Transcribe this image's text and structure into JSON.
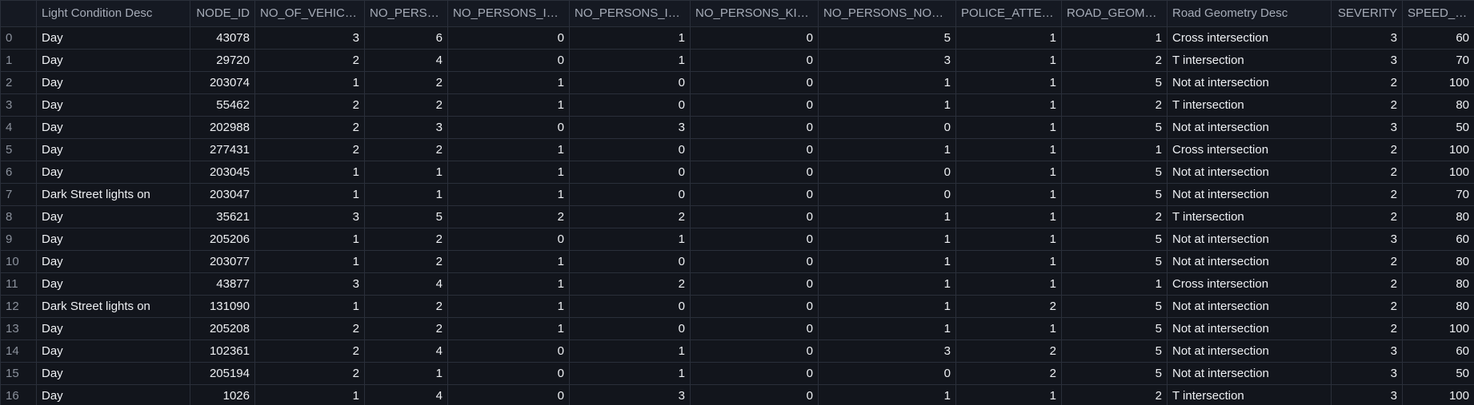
{
  "table": {
    "columns": [
      {
        "label": "",
        "align": "left"
      },
      {
        "label": "Light Condition Desc",
        "align": "left"
      },
      {
        "label": "NODE_ID",
        "align": "right"
      },
      {
        "label": "NO_OF_VEHICLES",
        "align": "right"
      },
      {
        "label": "NO_PERSO...",
        "align": "right"
      },
      {
        "label": "NO_PERSONS_INJ...",
        "align": "right"
      },
      {
        "label": "NO_PERSONS_INJ...",
        "align": "right"
      },
      {
        "label": "NO_PERSONS_KILL...",
        "align": "right"
      },
      {
        "label": "NO_PERSONS_NOT_...",
        "align": "right"
      },
      {
        "label": "POLICE_ATTEND",
        "align": "right"
      },
      {
        "label": "ROAD_GEOME...",
        "align": "right"
      },
      {
        "label": "Road Geometry Desc",
        "align": "left"
      },
      {
        "label": "SEVERITY",
        "align": "right"
      },
      {
        "label": "SPEED_ZONE",
        "align": "right"
      }
    ],
    "rows": [
      [
        "0",
        "Day",
        "43078",
        "3",
        "6",
        "0",
        "1",
        "0",
        "5",
        "1",
        "1",
        "Cross intersection",
        "3",
        "60"
      ],
      [
        "1",
        "Day",
        "29720",
        "2",
        "4",
        "0",
        "1",
        "0",
        "3",
        "1",
        "2",
        "T intersection",
        "3",
        "70"
      ],
      [
        "2",
        "Day",
        "203074",
        "1",
        "2",
        "1",
        "0",
        "0",
        "1",
        "1",
        "5",
        "Not at intersection",
        "2",
        "100"
      ],
      [
        "3",
        "Day",
        "55462",
        "2",
        "2",
        "1",
        "0",
        "0",
        "1",
        "1",
        "2",
        "T intersection",
        "2",
        "80"
      ],
      [
        "4",
        "Day",
        "202988",
        "2",
        "3",
        "0",
        "3",
        "0",
        "0",
        "1",
        "5",
        "Not at intersection",
        "3",
        "50"
      ],
      [
        "5",
        "Day",
        "277431",
        "2",
        "2",
        "1",
        "0",
        "0",
        "1",
        "1",
        "1",
        "Cross intersection",
        "2",
        "100"
      ],
      [
        "6",
        "Day",
        "203045",
        "1",
        "1",
        "1",
        "0",
        "0",
        "0",
        "1",
        "5",
        "Not at intersection",
        "2",
        "100"
      ],
      [
        "7",
        "Dark Street lights on",
        "203047",
        "1",
        "1",
        "1",
        "0",
        "0",
        "0",
        "1",
        "5",
        "Not at intersection",
        "2",
        "70"
      ],
      [
        "8",
        "Day",
        "35621",
        "3",
        "5",
        "2",
        "2",
        "0",
        "1",
        "1",
        "2",
        "T intersection",
        "2",
        "80"
      ],
      [
        "9",
        "Day",
        "205206",
        "1",
        "2",
        "0",
        "1",
        "0",
        "1",
        "1",
        "5",
        "Not at intersection",
        "3",
        "60"
      ],
      [
        "10",
        "Day",
        "203077",
        "1",
        "2",
        "1",
        "0",
        "0",
        "1",
        "1",
        "5",
        "Not at intersection",
        "2",
        "80"
      ],
      [
        "11",
        "Day",
        "43877",
        "3",
        "4",
        "1",
        "2",
        "0",
        "1",
        "1",
        "1",
        "Cross intersection",
        "2",
        "80"
      ],
      [
        "12",
        "Dark Street lights on",
        "131090",
        "1",
        "2",
        "1",
        "0",
        "0",
        "1",
        "2",
        "5",
        "Not at intersection",
        "2",
        "80"
      ],
      [
        "13",
        "Day",
        "205208",
        "2",
        "2",
        "1",
        "0",
        "0",
        "1",
        "1",
        "5",
        "Not at intersection",
        "2",
        "100"
      ],
      [
        "14",
        "Day",
        "102361",
        "2",
        "4",
        "0",
        "1",
        "0",
        "3",
        "2",
        "5",
        "Not at intersection",
        "3",
        "60"
      ],
      [
        "15",
        "Day",
        "205194",
        "2",
        "1",
        "0",
        "1",
        "0",
        "0",
        "2",
        "5",
        "Not at intersection",
        "3",
        "50"
      ],
      [
        "16",
        "Day",
        "1026",
        "1",
        "4",
        "0",
        "3",
        "0",
        "1",
        "1",
        "2",
        "T intersection",
        "3",
        "100"
      ]
    ]
  }
}
